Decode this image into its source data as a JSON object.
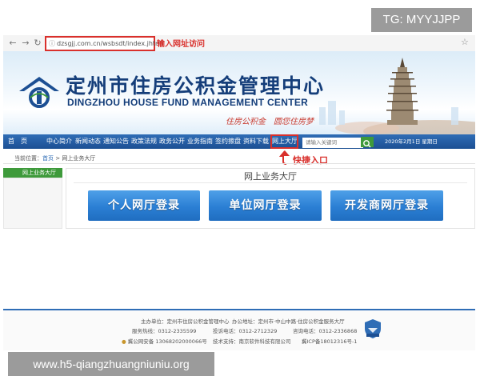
{
  "watermark_top": "TG: MYYJJPP",
  "watermark_bottom": "www.h5-qiangzhuangniuniu.org",
  "browser": {
    "back_icon": "back-arrow-icon",
    "forward_icon": "forward-arrow-icon",
    "reload_icon": "reload-icon",
    "url": "dzsgjj.com.cn/wsbsdt/index.jhtml",
    "url_annotation": "输入网址访问",
    "bookmark_icon": "star-icon"
  },
  "banner": {
    "title_cn": "定州市住房公积金管理中心",
    "title_en": "DINGZHOU HOUSE FUND MANAGEMENT CENTER",
    "slogan": "住房公积金　圆您住房梦"
  },
  "nav": {
    "items": [
      "首　页",
      "中心简介",
      "新闻动态",
      "通知公告",
      "政策法规",
      "政务公开",
      "业务指南",
      "签约擦盘",
      "资料下载",
      "网上大厅"
    ],
    "search_placeholder": "请输入关键词",
    "search_icon": "search-icon",
    "date": "2020年2月1日 星期日",
    "highlight_annotation": "快捷入口"
  },
  "breadcrumb": {
    "prefix": "当前位置：",
    "home": "首页",
    "separator": ">",
    "current": "网上业务大厅"
  },
  "sidebar": {
    "tab_label": "网上业务大厅"
  },
  "main": {
    "title": "网上业务大厅",
    "buttons": [
      "个人网厅登录",
      "单位网厅登录",
      "开发商网厅登录"
    ]
  },
  "footer": {
    "host": "主办单位：定州市住房公积金管理中心",
    "address": "办公地址：定州市·中山中路·住房公积金服务大厅",
    "service_phone": "服务热线：0312-2335599",
    "report_phone": "投诉电话：0312-2712329",
    "consult_phone": "咨询电话：0312-2336868",
    "police_record": "冀公网安备 13068202000066号",
    "tech_support": "技术支持：南京软件科技有限公司",
    "icp": "冀ICP备18012316号-1",
    "police_icon": "police-emblem-icon",
    "gov_badge_icon": "gov-site-badge-icon"
  },
  "colors": {
    "accent_red": "#d9302c",
    "nav_blue": "#2f6db6",
    "title_blue": "#153e7a",
    "button_blue": "#2b7fd4",
    "green": "#3e9a3b"
  }
}
